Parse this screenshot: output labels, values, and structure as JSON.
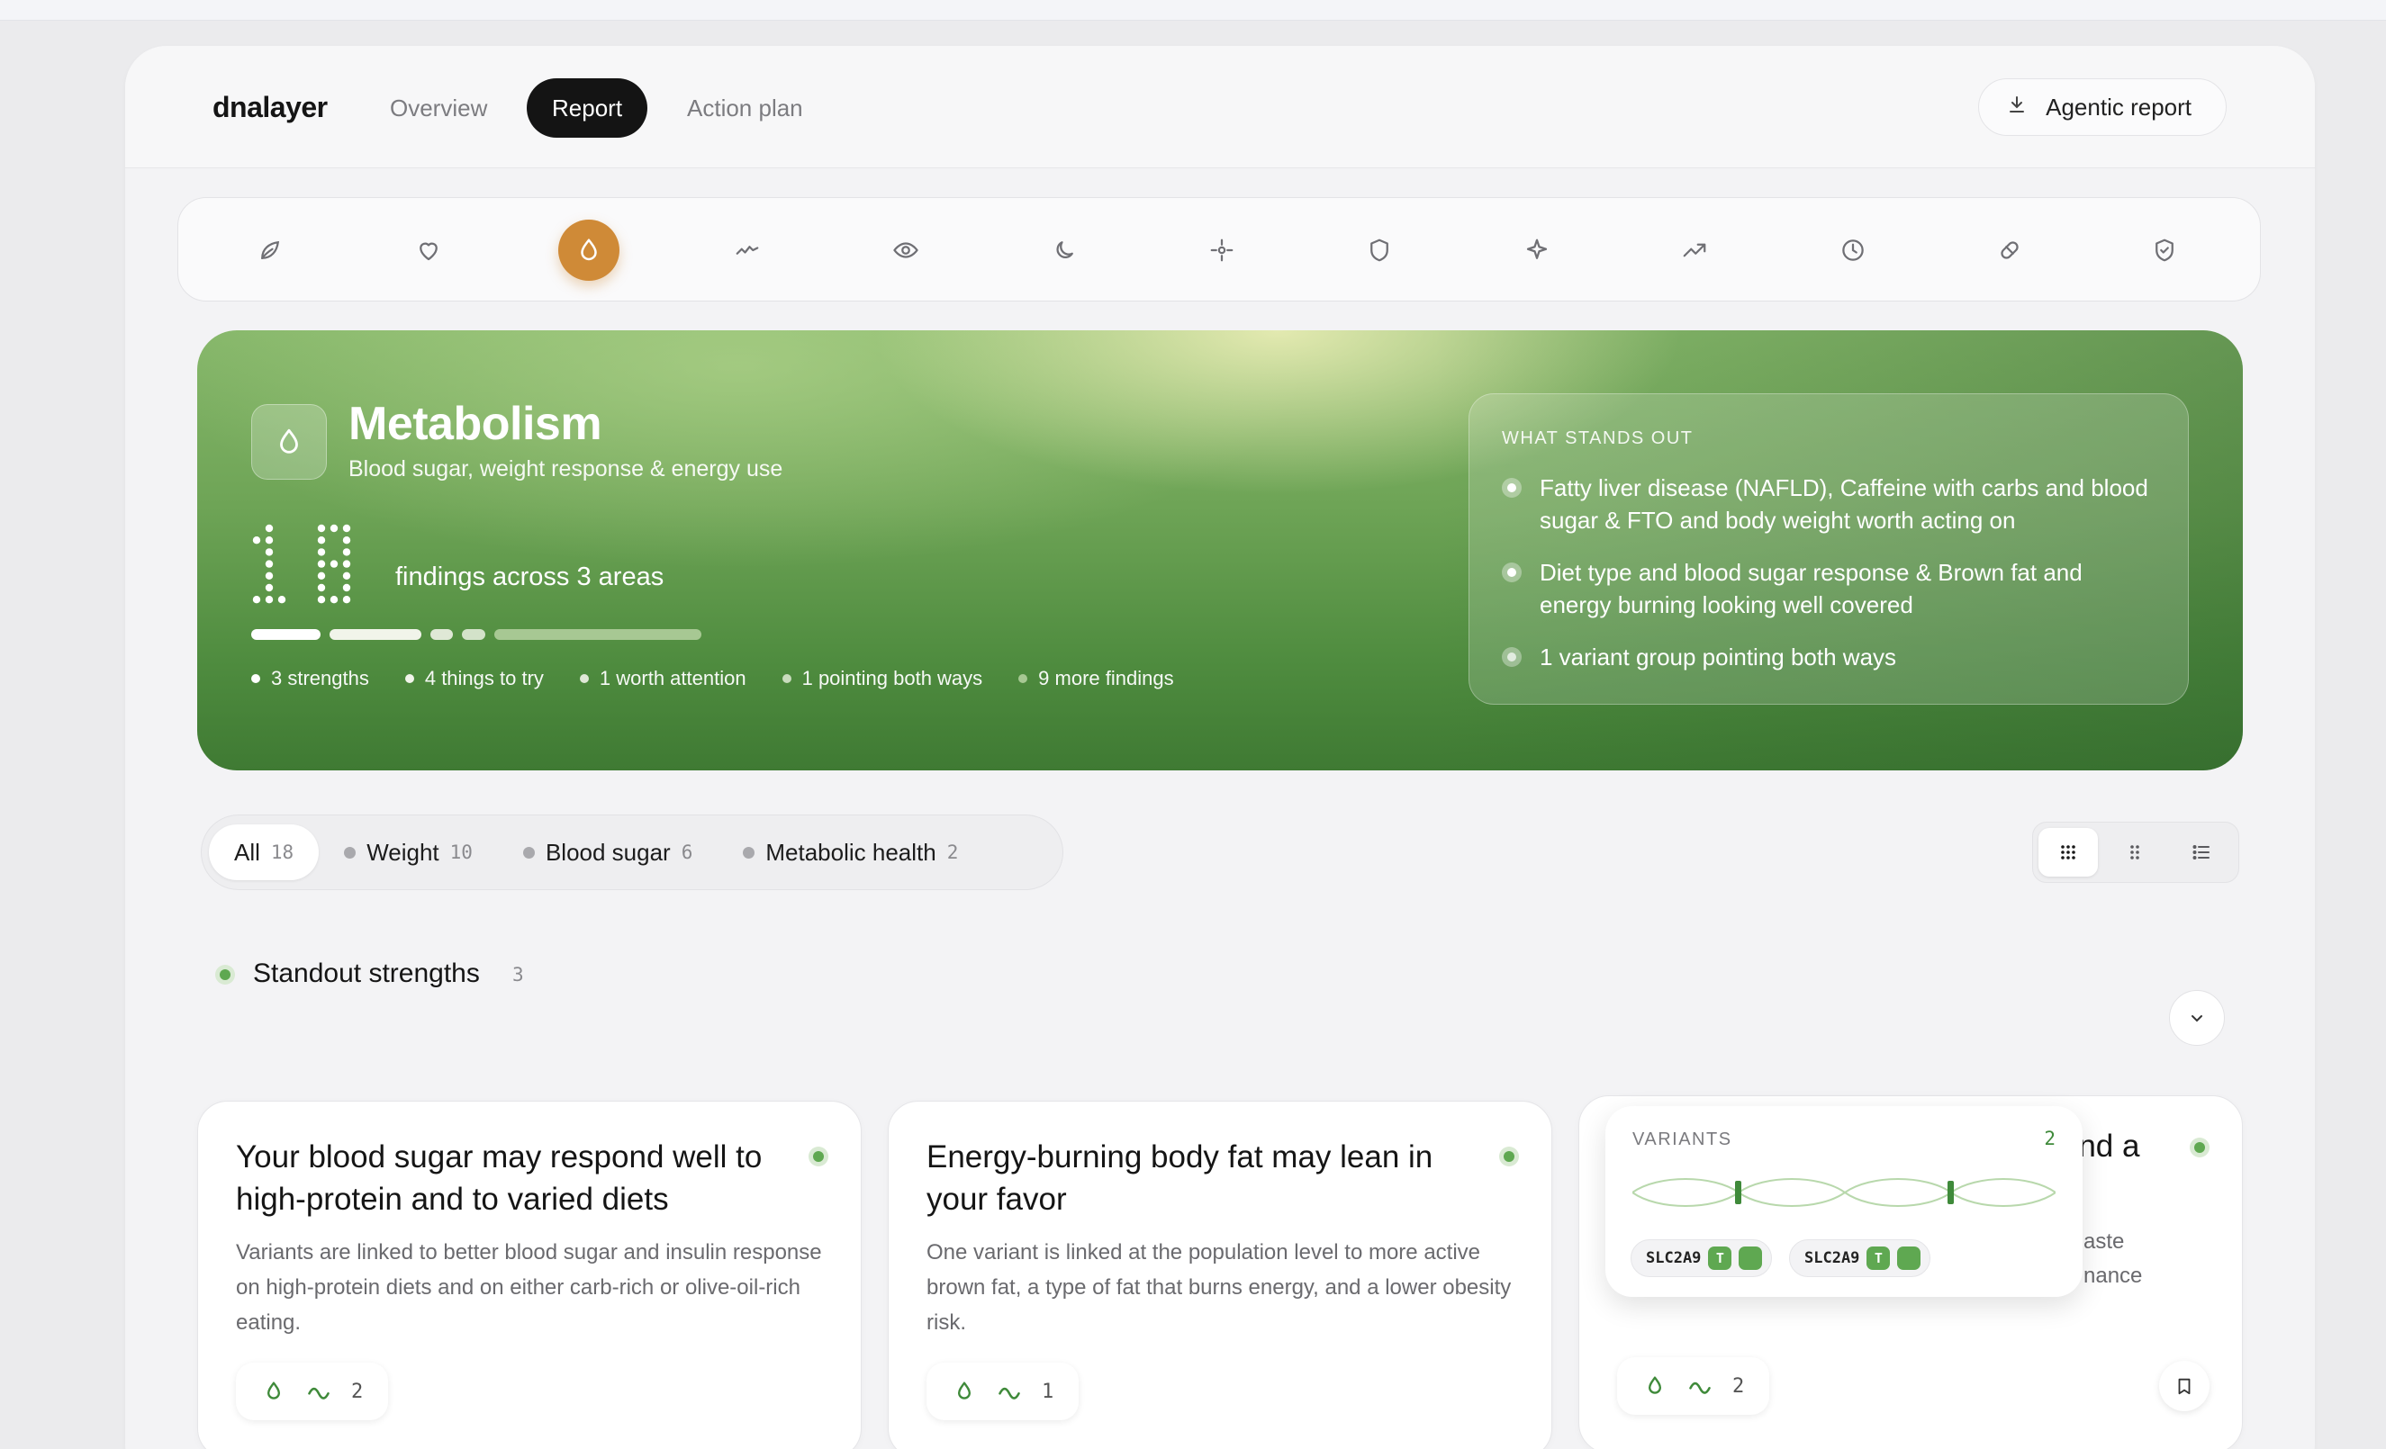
{
  "header": {
    "brand": "dnalayer",
    "tabs": [
      {
        "label": "Overview",
        "active": false
      },
      {
        "label": "Report",
        "active": true
      },
      {
        "label": "Action plan",
        "active": false
      }
    ],
    "agentic_label": "Agentic report"
  },
  "rail": {
    "icons": [
      "leaf-icon",
      "heart-icon",
      "drop-icon",
      "activity-icon",
      "eye-icon",
      "moon-icon",
      "target-icon",
      "shield-icon",
      "sparkle-icon",
      "trend-up-icon",
      "clock-icon",
      "pill-icon",
      "shield-check-icon"
    ],
    "active_index": 2,
    "accent": "#cf8a37"
  },
  "hero": {
    "title": "Metabolism",
    "subtitle": "Blood sugar, weight response & energy use",
    "count": "18",
    "count_label": "findings across 3 areas",
    "progress": [
      {
        "value": 3,
        "color": "#ffffff"
      },
      {
        "value": 4,
        "color": "#f1f4ea"
      },
      {
        "value": 1,
        "color": "#dfe8d6"
      },
      {
        "value": 1,
        "color": "#d3e2c9"
      },
      {
        "value": 9,
        "color": "#a7c893"
      }
    ],
    "legend": [
      {
        "label": "3 strengths",
        "color": "#ffffff"
      },
      {
        "label": "4 things to try",
        "color": "#f1f4ea"
      },
      {
        "label": "1 worth attention",
        "color": "#dfe8d6"
      },
      {
        "label": "1 pointing both ways",
        "color": "#c9dcbd"
      },
      {
        "label": "9 more findings",
        "color": "#a7c893"
      }
    ],
    "standout": {
      "heading": "WHAT STANDS OUT",
      "items": [
        "Fatty liver disease (NAFLD), Caffeine with carbs and blood sugar & FTO and body weight worth acting on",
        "Diet type and blood sugar response & Brown fat and energy burning looking well covered",
        "1 variant group pointing both ways"
      ]
    }
  },
  "filters": {
    "chips": [
      {
        "label": "All",
        "count": "18",
        "active": true
      },
      {
        "label": "Weight",
        "count": "10",
        "active": false
      },
      {
        "label": "Blood sugar",
        "count": "6",
        "active": false
      },
      {
        "label": "Metabolic health",
        "count": "2",
        "active": false
      }
    ],
    "views": [
      "grid-icon",
      "dots-grid-icon",
      "list-icon"
    ]
  },
  "section": {
    "title": "Standout strengths",
    "count": "3",
    "accent": "#5fa851"
  },
  "cards": [
    {
      "title": "Your blood sugar may respond well to high-protein and to varied diets",
      "description": "Variants are linked to better blood sugar and insulin response on high-protein diets and on either carb-rich or olive-oil-rich eating.",
      "variant_count": "2"
    },
    {
      "title": "Energy-burning body fat may lean in your favor",
      "description": "One variant is linked at the population level to more active brown fat, a type of fat that burns energy, and a lower obesity risk.",
      "variant_count": "1"
    },
    {
      "title": "You lean toward lower uric acid and a",
      "description_fragments": [
        "aste",
        "nance"
      ],
      "variant_count": "2"
    }
  ],
  "variants_popover": {
    "heading": "VARIANTS",
    "count": "2",
    "genes": [
      {
        "gene": "SLC2A9",
        "allele": "T"
      },
      {
        "gene": "SLC2A9",
        "allele": "T"
      }
    ]
  }
}
